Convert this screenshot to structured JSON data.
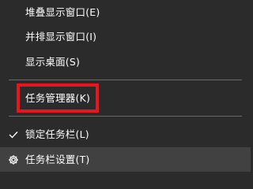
{
  "menu": {
    "items": [
      {
        "label": "堆叠显示窗口(E)"
      },
      {
        "label": "并排显示窗口(I)"
      },
      {
        "label": "显示桌面(S)"
      },
      {
        "label": "任务管理器(K)"
      },
      {
        "label": "锁定任务栏(L)",
        "checked": true,
        "icon": "checkmark-icon"
      },
      {
        "label": "任务栏设置(T)",
        "icon": "gear-icon"
      }
    ]
  },
  "colors": {
    "background": "#2b2b2b",
    "hover_background": "#414141",
    "separator": "#6a6a6a",
    "text": "#ffffff",
    "highlight": "#e8151c"
  }
}
